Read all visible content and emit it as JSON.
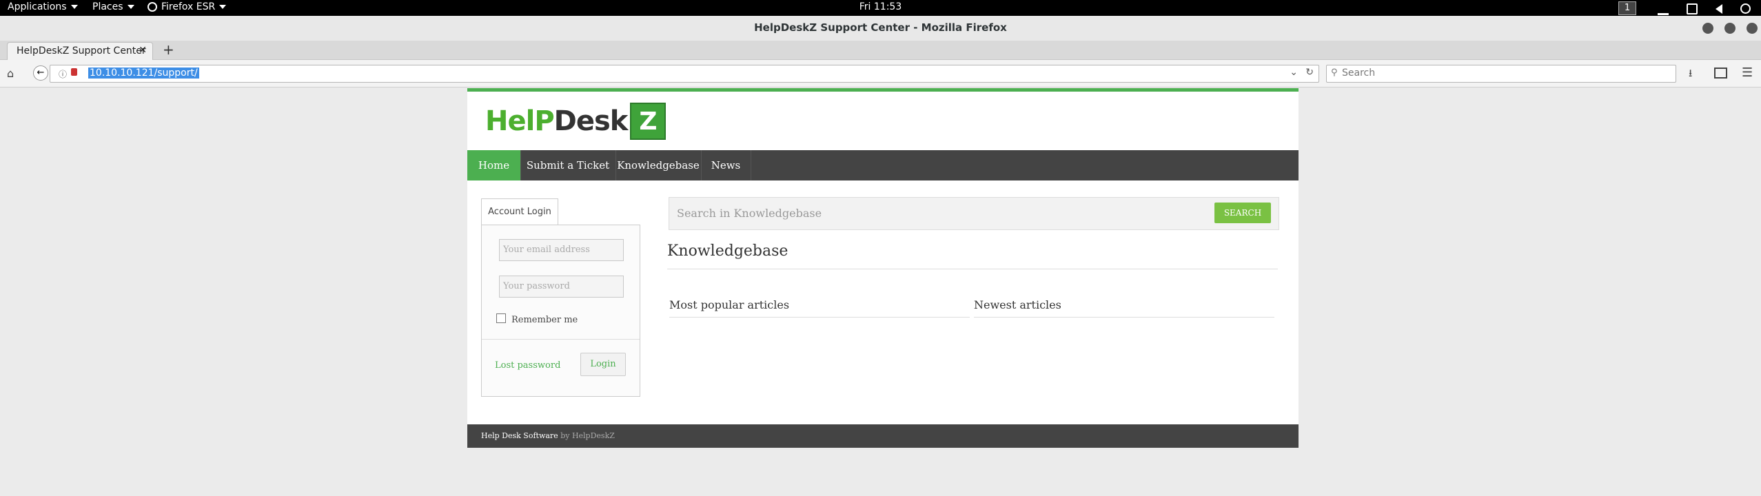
{
  "desktop": {
    "applications_label": "Applications",
    "places_label": "Places",
    "firefox_label": "Firefox ESR",
    "clock": "Fri 11:53",
    "workspace": "1"
  },
  "window": {
    "title": "HelpDeskZ Support Center - Mozilla Firefox"
  },
  "browser": {
    "tab_title": "HelpDeskZ Support Center",
    "url": "10.10.10.121/support/",
    "search_placeholder": "Search"
  },
  "site": {
    "logo_help": "HelP",
    "logo_desk": "Desk",
    "logo_z": "Z",
    "nav": [
      "Home",
      "Submit a Ticket",
      "Knowledgebase",
      "News"
    ],
    "login": {
      "tab_label": "Account Login",
      "email_placeholder": "Your email address",
      "password_placeholder": "Your password",
      "remember_label": "Remember me",
      "lost_password": "Lost password",
      "login_button": "Login"
    },
    "kb": {
      "search_placeholder": "Search in Knowledgebase",
      "search_button": "SEARCH",
      "title": "Knowledgebase",
      "popular": "Most popular articles",
      "newest": "Newest articles"
    },
    "footer": {
      "text": "Help Desk Software",
      "by": "by HelpDeskZ"
    }
  },
  "colors": {
    "brand_green": "#4caf50",
    "search_button": "#7ac143",
    "nav_bg": "#444444"
  }
}
